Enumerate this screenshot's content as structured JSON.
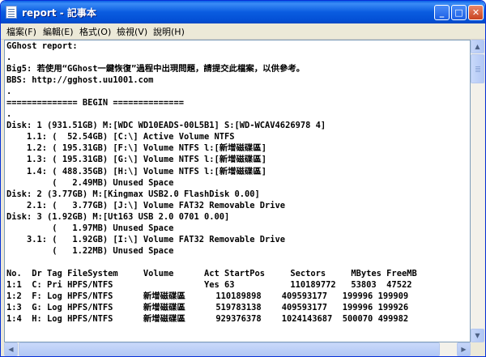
{
  "window": {
    "title": "report - 記事本",
    "min_label": "_",
    "max_label": "□",
    "close_label": "✕",
    "icon": "notepad-icon"
  },
  "menu": {
    "items": [
      {
        "label": "檔案(F)"
      },
      {
        "label": "編輯(E)"
      },
      {
        "label": "格式(O)"
      },
      {
        "label": "檢視(V)"
      },
      {
        "label": "說明(H)"
      }
    ]
  },
  "document": {
    "lines": [
      "GGhost report:",
      ".",
      "Big5: 若使用“GGhost一鍵恢復”過程中出現問題，請提交此檔案，以供參考。",
      "BBS: http://gghost.uu1001.com",
      ".",
      "============== BEGIN ==============",
      ".",
      "Disk: 1 (931.51GB) M:[WDC WD10EADS-00L5B1] S:[WD-WCAV4626978 4]",
      "    1.1: (  52.54GB) [C:\\] Active Volume NTFS",
      "    1.2: ( 195.31GB) [F:\\] Volume NTFS l:[新增磁碟區]",
      "    1.3: ( 195.31GB) [G:\\] Volume NTFS l:[新增磁碟區]",
      "    1.4: ( 488.35GB) [H:\\] Volume NTFS l:[新增磁碟區]",
      "         (   2.49MB) Unused Space",
      "Disk: 2 (3.77GB) M:[Kingmax USB2.0 FlashDisk 0.00]",
      "    2.1: (   3.77GB) [J:\\] Volume FAT32 Removable Drive",
      "Disk: 3 (1.92GB) M:[Ut163 USB 2.0 0701 0.00]",
      "         (   1.97MB) Unused Space",
      "    3.1: (   1.92GB) [I:\\] Volume FAT32 Removable Drive",
      "         (   1.22MB) Unused Space",
      "",
      "No.  Dr Tag FileSystem     Volume      Act StartPos     Sectors     MBytes FreeMB",
      "1:1  C: Pri HPFS/NTFS                  Yes 63           110189772   53803  47522",
      "1:2  F: Log HPFS/NTFS      新增磁碟區      110189898    409593177   199996 199909",
      "1:3  G: Log HPFS/NTFS      新增磁碟區      519783138    409593177   199996 199926",
      "1:4  H: Log HPFS/NTFS      新增磁碟區      929376378    1024143687  500070 499982"
    ]
  }
}
